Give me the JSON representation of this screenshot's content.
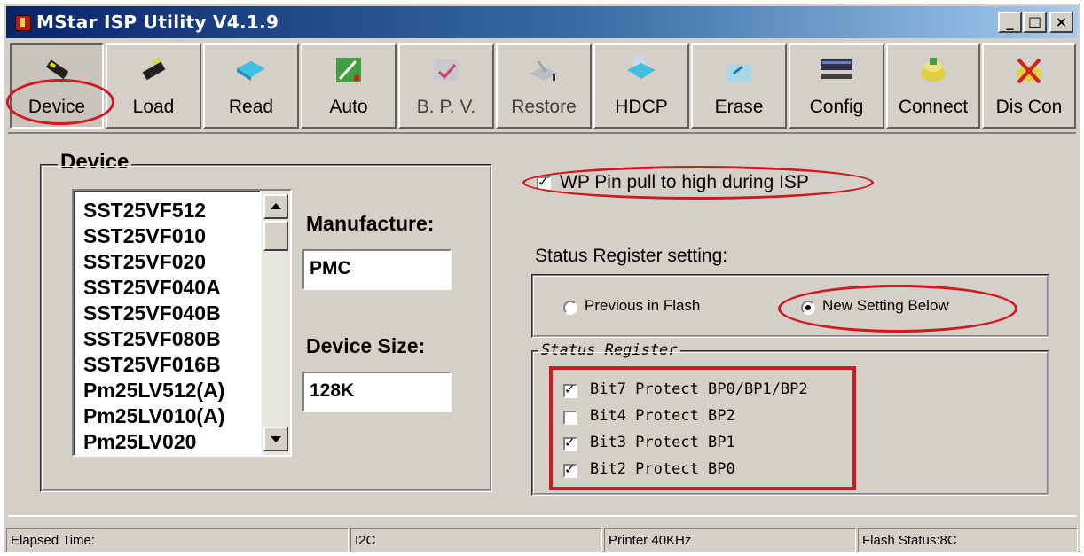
{
  "window": {
    "title": "MStar ISP Utility V4.1.9",
    "buttons": {
      "minimize": "_",
      "maximize": "□",
      "close": "×"
    }
  },
  "toolbar": {
    "buttons": [
      {
        "label": "Device",
        "icon": "device-chip-icon",
        "pressed": true
      },
      {
        "label": "Load",
        "icon": "load-chip-icon"
      },
      {
        "label": "Read",
        "icon": "read-icon"
      },
      {
        "label": "Auto",
        "icon": "auto-icon"
      },
      {
        "label": "B. P. V.",
        "icon": "bpv-icon",
        "disabled": true
      },
      {
        "label": "Restore",
        "icon": "restore-icon",
        "disabled": true
      },
      {
        "label": "HDCP",
        "icon": "hdcp-icon"
      },
      {
        "label": "Erase",
        "icon": "erase-icon"
      },
      {
        "label": "Config",
        "icon": "config-icon"
      },
      {
        "label": "Connect",
        "icon": "connect-icon"
      },
      {
        "label": "Dis Con",
        "icon": "disconnect-icon"
      }
    ]
  },
  "device_group": {
    "title": "Device",
    "list_items": [
      "SST25VF512",
      "SST25VF010",
      "SST25VF020",
      "SST25VF040A",
      "SST25VF040B",
      "SST25VF080B",
      "SST25VF016B",
      "Pm25LV512(A)",
      "Pm25LV010(A)",
      "Pm25LV020"
    ],
    "manufacture_label": "Manufacture:",
    "manufacture_value": "PMC",
    "size_label": "Device Size:",
    "size_value": "128K"
  },
  "wp_pin": {
    "label": "WP Pin pull to high during ISP",
    "checked": true
  },
  "status_register_setting": {
    "label": "Status Register setting:",
    "options": [
      {
        "label": "Previous in Flash",
        "selected": false
      },
      {
        "label": "New Setting Below",
        "selected": true
      }
    ]
  },
  "status_register": {
    "title": "Status Register",
    "bits": [
      {
        "label": "Bit7 Protect BP0/BP1/BP2",
        "checked": true
      },
      {
        "label": "Bit4 Protect BP2",
        "checked": false
      },
      {
        "label": "Bit3 Protect BP1",
        "checked": true
      },
      {
        "label": "Bit2 Protect BP0",
        "checked": true
      }
    ]
  },
  "statusbar": {
    "elapsed": "Elapsed Time:",
    "interface": "I2C",
    "printer": "Printer  40KHz",
    "flash_status": "Flash Status:8C"
  },
  "colors": {
    "annotation": "#d01820",
    "face": "#d4d0c8",
    "title_start": "#0a246a",
    "title_end": "#a6caf0"
  }
}
